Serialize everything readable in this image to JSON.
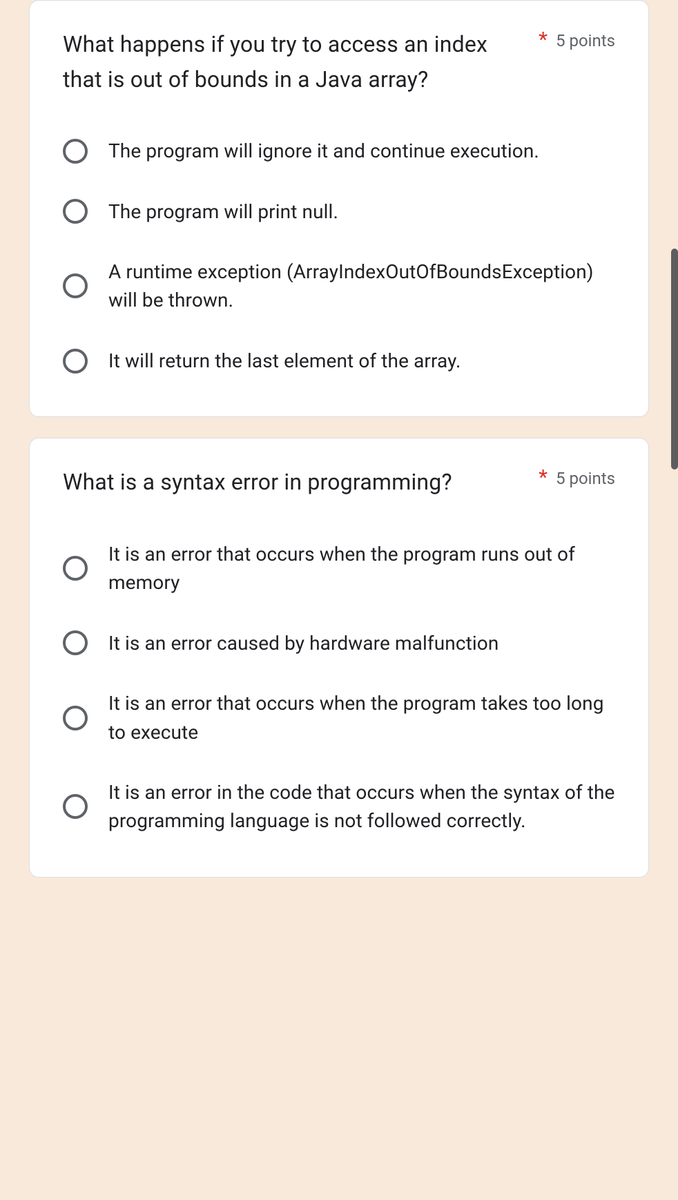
{
  "questions": [
    {
      "title": "What happens if you try to access an index that is out of bounds in a Java array?",
      "required": "*",
      "points": "5 points",
      "options": [
        "The program will ignore it and continue execution.",
        "The program will print null.",
        "A runtime exception (ArrayIndexOutOfBoundsException) will be thrown.",
        "It will return the last element of the array."
      ]
    },
    {
      "title": "What is a syntax error in programming?",
      "required": "*",
      "points": "5 points",
      "options": [
        "It is an error that occurs when the program runs out of memory",
        "It is an error caused by hardware malfunction",
        "It is an error that occurs when the program takes too long to execute",
        "It is an error in the code that occurs when the syntax of the programming language is not followed correctly."
      ]
    }
  ]
}
